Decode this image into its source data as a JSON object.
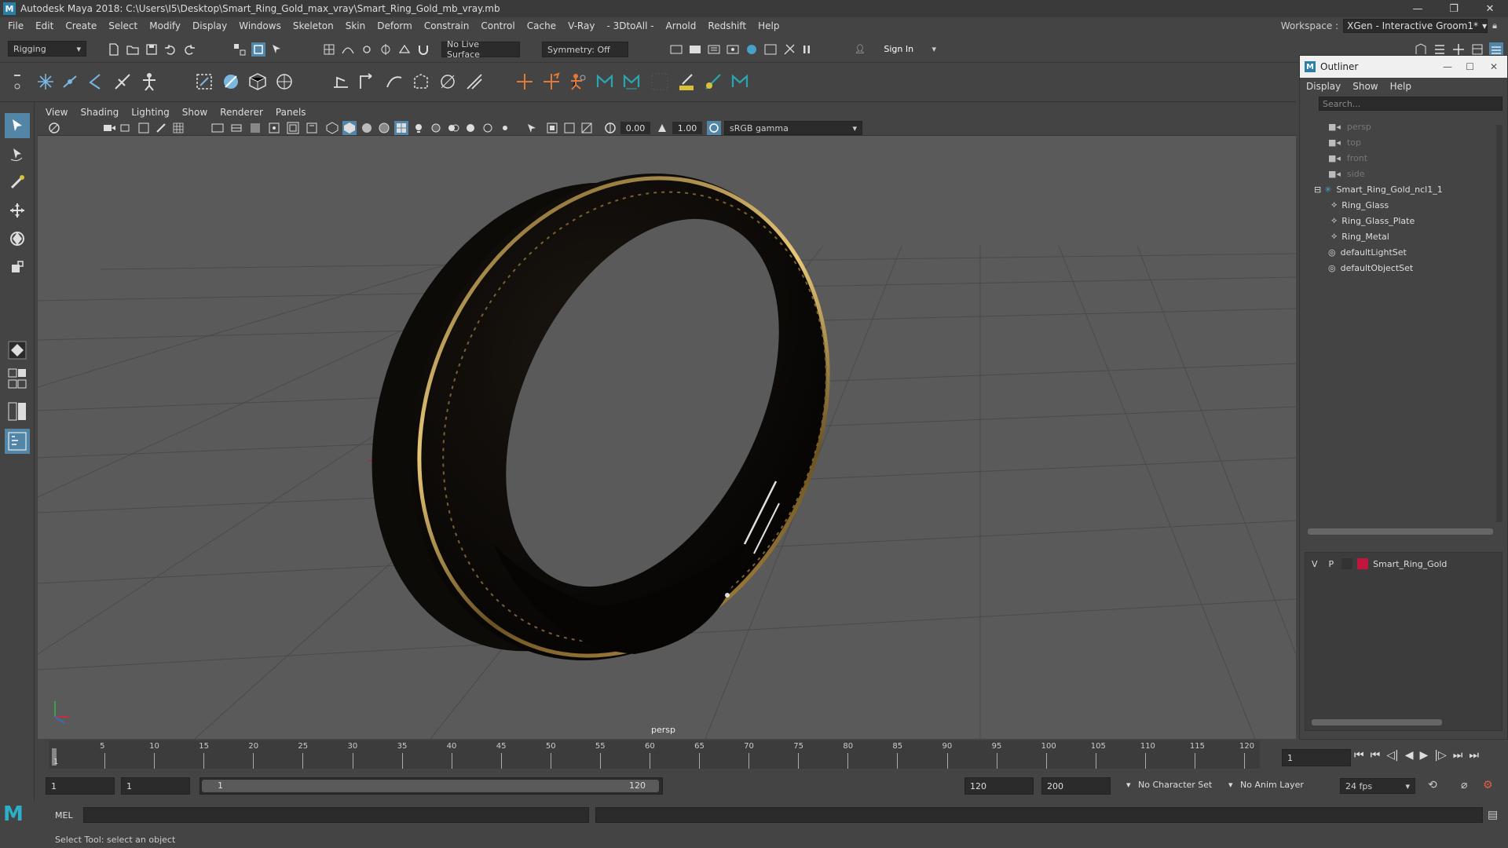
{
  "window": {
    "title": "Autodesk Maya 2018: C:\\Users\\I5\\Desktop\\Smart_Ring_Gold_max_vray\\Smart_Ring_Gold_mb_vray.mb",
    "minimize": "—",
    "maximize": "❐",
    "close": "✕"
  },
  "menubar": {
    "items": [
      "File",
      "Edit",
      "Create",
      "Select",
      "Modify",
      "Display",
      "Windows",
      "Skeleton",
      "Skin",
      "Deform",
      "Constrain",
      "Control",
      "Cache",
      "V-Ray",
      "- 3DtoAll -",
      "Arnold",
      "Redshift",
      "Help"
    ],
    "workspace_label": "Workspace :",
    "workspace_value": "XGen - Interactive Groom1*"
  },
  "statusline": {
    "mode": "Rigging",
    "live_surface": "No Live Surface",
    "symmetry": "Symmetry: Off",
    "sign_in": "Sign In"
  },
  "viewport": {
    "menu": [
      "View",
      "Shading",
      "Lighting",
      "Show",
      "Renderer",
      "Panels"
    ],
    "exposure": "0.00",
    "gamma": "1.00",
    "color_space": "sRGB gamma",
    "camera_label": "persp"
  },
  "outliner": {
    "title": "Outliner",
    "menu": [
      "Display",
      "Show",
      "Help"
    ],
    "search_placeholder": "Search...",
    "items": [
      {
        "label": "persp",
        "kind": "camera",
        "dim": true
      },
      {
        "label": "top",
        "kind": "camera",
        "dim": true
      },
      {
        "label": "front",
        "kind": "camera",
        "dim": true
      },
      {
        "label": "side",
        "kind": "camera",
        "dim": true
      },
      {
        "label": "Smart_Ring_Gold_ncl1_1",
        "kind": "group",
        "dim": false
      },
      {
        "label": "Ring_Glass",
        "kind": "mesh",
        "dim": false
      },
      {
        "label": "Ring_Glass_Plate",
        "kind": "mesh",
        "dim": false
      },
      {
        "label": "Ring_Metal",
        "kind": "mesh",
        "dim": false
      },
      {
        "label": "defaultLightSet",
        "kind": "set",
        "dim": false
      },
      {
        "label": "defaultObjectSet",
        "kind": "set",
        "dim": false
      }
    ],
    "layer": {
      "v": "V",
      "p": "P",
      "name": "Smart_Ring_Gold",
      "color": "#c0163c"
    }
  },
  "timeline": {
    "ticks": [
      "5",
      "10",
      "15",
      "20",
      "25",
      "30",
      "35",
      "40",
      "45",
      "50",
      "55",
      "60",
      "65",
      "70",
      "75",
      "80",
      "85",
      "90",
      "95",
      "100",
      "105",
      "110",
      "115",
      "120"
    ],
    "first_tick": "1",
    "current_frame": "1"
  },
  "range": {
    "start": "1",
    "playback_start": "1",
    "slider_start": "1",
    "slider_end": "120",
    "playback_end": "120",
    "end": "200",
    "character_set": "No Character Set",
    "anim_layer": "No Anim Layer",
    "fps": "24 fps"
  },
  "cmdline": {
    "lang": "MEL"
  },
  "helpline": {
    "text": "Select Tool: select an object"
  },
  "colors": {
    "accent": "#5285a6",
    "ui_bg": "#444444",
    "viewport_bg": "#5a5a5a",
    "ring_gold": "#c9a04a"
  }
}
